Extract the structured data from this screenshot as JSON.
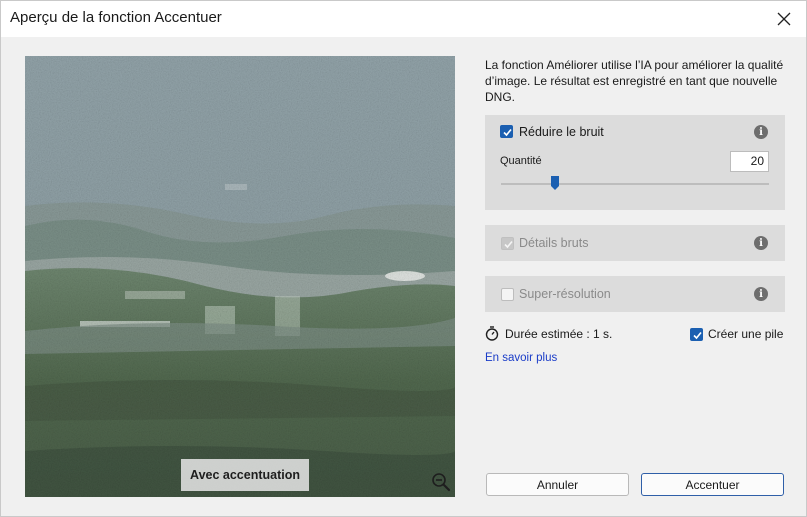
{
  "window": {
    "title": "Aperçu de la fonction Accentuer"
  },
  "preview": {
    "overlay_label": "Avec accentuation"
  },
  "panel": {
    "description": "La fonction Améliorer utilise l’IA pour améliorer la qualité d’image. Le résultat est enregistré en tant que nouvelle DNG.",
    "denoise": {
      "label": "Réduire le bruit",
      "checked": true,
      "quantity_label": "Quantité",
      "quantity_value": "20",
      "slider_min": 0,
      "slider_max": 100
    },
    "raw_details": {
      "label": "Détails bruts",
      "checked": true,
      "enabled": false
    },
    "super_resolution": {
      "label": "Super-résolution",
      "checked": false,
      "enabled": false
    },
    "duration": "Durée estimée : 1 s.",
    "create_stack": {
      "label": "Créer une pile",
      "checked": true
    },
    "learn_more": "En savoir plus"
  },
  "buttons": {
    "cancel": "Annuler",
    "ok": "Accentuer"
  },
  "colors": {
    "accent": "#1b5fb1",
    "link": "#1a3cc8",
    "section_bg": "#dcdcdc"
  },
  "icons": {
    "close": "close-icon",
    "zoom": "zoom-out-icon",
    "info": "info-icon",
    "stopwatch": "stopwatch-icon",
    "check": "checkmark-icon"
  }
}
